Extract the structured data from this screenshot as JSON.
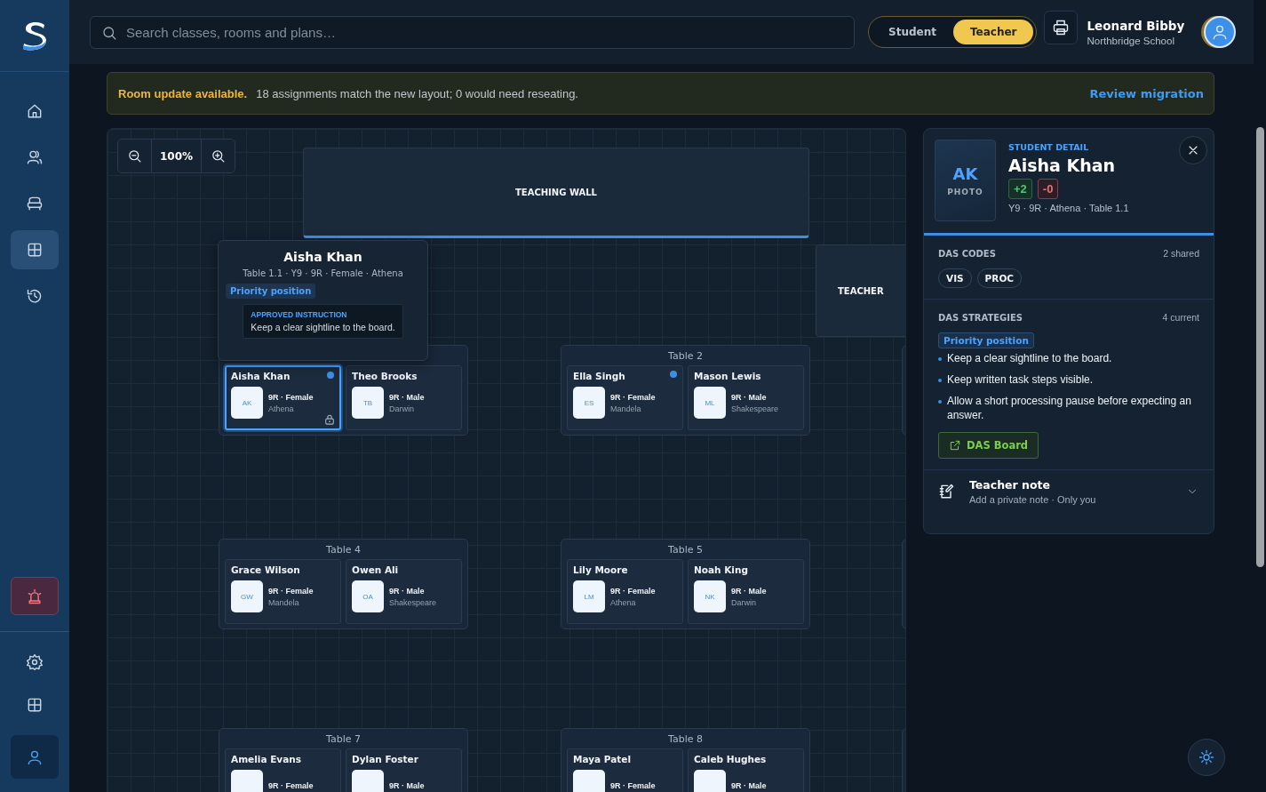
{
  "sidebar": {
    "nav": [
      {
        "selected": false
      },
      {
        "selected": false
      },
      {
        "selected": false
      },
      {
        "selected": true
      },
      {
        "selected": false
      }
    ],
    "account": {
      "selected": true
    }
  },
  "topbar": {
    "search_placeholder": "Search classes, rooms and plans…",
    "roles": [
      {
        "label": "Student",
        "selected": false
      },
      {
        "label": "Teacher",
        "selected": true
      }
    ],
    "user_name": "Leonard Bibby",
    "school": "Northbridge School"
  },
  "banner": {
    "title": "Room update available.",
    "message": "18 assignments match the new layout; 0 would need reseating.",
    "action": "Review migration"
  },
  "canvas": {
    "zoom": "100%",
    "teaching_wall": "TEACHING WALL",
    "teacher_desk": "TEACHER",
    "table_rows": [
      [
        {
          "seats": [
            {
              "name": "Aisha Khan",
              "initials": "AK",
              "details": "9R · Female",
              "house": "Athena",
              "flagged": true,
              "selected": true,
              "locked": true
            },
            {
              "name": "Theo Brooks",
              "initials": "TB",
              "details": "9R · Male",
              "house": "Darwin",
              "flagged": false,
              "selected": false,
              "locked": false
            }
          ]
        },
        {
          "title": "Table 2",
          "seats": [
            {
              "name": "Ella Singh",
              "initials": "ES",
              "details": "9R · Female",
              "house": "Mandela",
              "flagged": true,
              "selected": false,
              "locked": false
            },
            {
              "name": "Mason Lewis",
              "initials": "ML",
              "details": "9R · Male",
              "house": "Shakespeare",
              "flagged": false,
              "selected": false,
              "locked": false
            }
          ]
        }
      ],
      [
        {
          "title": "Table 4",
          "seats": [
            {
              "name": "Grace Wilson",
              "initials": "GW",
              "details": "9R · Female",
              "house": "Mandela",
              "flagged": false,
              "selected": false,
              "locked": false
            },
            {
              "name": "Owen Ali",
              "initials": "OA",
              "details": "9R · Male",
              "house": "Shakespeare",
              "flagged": false,
              "selected": false,
              "locked": false
            }
          ]
        },
        {
          "title": "Table 5",
          "seats": [
            {
              "name": "Lily Moore",
              "initials": "LM",
              "details": "9R · Female",
              "house": "Athena",
              "flagged": false,
              "selected": false,
              "locked": false
            },
            {
              "name": "Noah King",
              "initials": "NK",
              "details": "9R · Male",
              "house": "Darwin",
              "flagged": false,
              "selected": false,
              "locked": false
            }
          ]
        }
      ],
      [
        {
          "title": "Table 7",
          "seats": [
            {
              "name": "Amelia Evans",
              "details": "9R · Female",
              "flagged": false,
              "selected": false,
              "locked": false
            },
            {
              "name": "Dylan Foster",
              "details": "9R · Male",
              "flagged": false,
              "selected": false,
              "locked": false
            }
          ]
        },
        {
          "title": "Table 8",
          "seats": [
            {
              "name": "Maya Patel",
              "details": "9R · Female",
              "flagged": false,
              "selected": false,
              "locked": false
            },
            {
              "name": "Caleb Hughes",
              "details": "9R · Male",
              "flagged": false,
              "selected": false,
              "locked": false
            }
          ]
        }
      ]
    ],
    "popover": {
      "name": "Aisha Khan",
      "meta": "Table 1.1 · Y9 · 9R · Female · Athena",
      "tag": "Priority position",
      "instruction_label": "APPROVED INSTRUCTION",
      "instruction": "Keep a clear sightline to the board."
    }
  },
  "panel": {
    "label": "STUDENT DETAIL",
    "photo_initials": "AK",
    "photo_label": "PHOTO",
    "name": "Aisha Khan",
    "merits": "+2",
    "demerits": "-0",
    "meta": "Y9 · 9R · Athena · Table 1.1",
    "codes_title": "DAS CODES",
    "codes_count": "2 shared",
    "codes": [
      "VIS",
      "PROC"
    ],
    "strategies_title": "DAS STRATEGIES",
    "strategies_count": "4 current",
    "strategy_tag": "Priority position",
    "strategies": [
      "Keep a clear sightline to the board.",
      "Keep written task steps visible.",
      "Allow a short processing pause before expecting an answer."
    ],
    "board_button": "DAS Board",
    "note_title": "Teacher note",
    "note_subtitle": "Add a private note · Only you"
  }
}
